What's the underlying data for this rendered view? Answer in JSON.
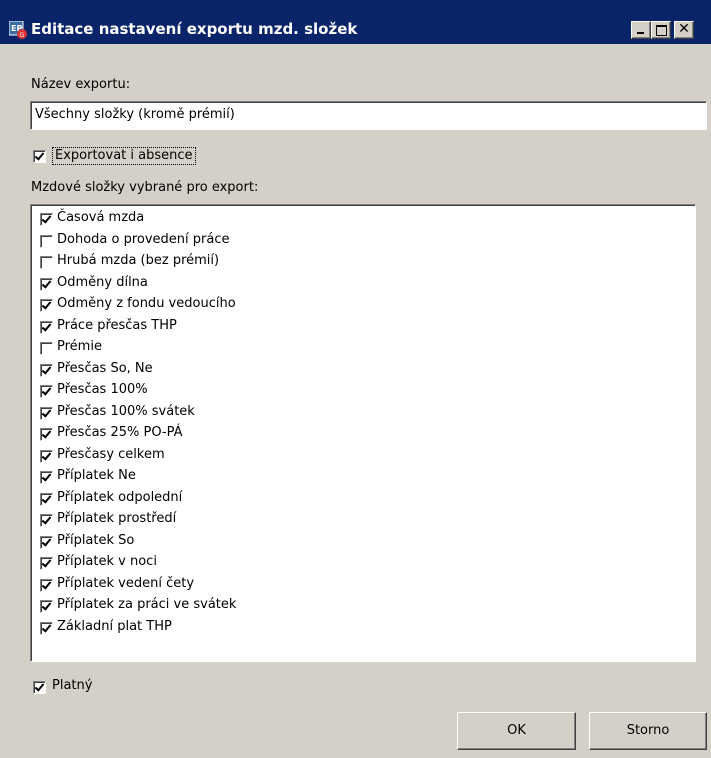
{
  "window": {
    "title": "Editace nastavení exportu mzd. složek",
    "icon": "app-icon",
    "controls": {
      "minimize": "minimize-icon",
      "maximize": "maximize-icon",
      "close": "✕"
    }
  },
  "form": {
    "name_label": "Název exportu:",
    "name_value": "Všechny složky (kromě prémií)",
    "export_absence": {
      "label": "Exportovat i absence",
      "checked": true
    },
    "list_label": "Mzdové složky vybrané pro export:",
    "items": [
      {
        "label": "Časová mzda",
        "checked": true
      },
      {
        "label": "Dohoda o provedení práce",
        "checked": false
      },
      {
        "label": "Hrubá mzda (bez prémií)",
        "checked": false
      },
      {
        "label": "Odměny dílna",
        "checked": true
      },
      {
        "label": "Odměny z fondu vedoucího",
        "checked": true
      },
      {
        "label": "Práce přesčas THP",
        "checked": true
      },
      {
        "label": "Prémie",
        "checked": false
      },
      {
        "label": "Přesčas  So, Ne",
        "checked": true
      },
      {
        "label": "Přesčas 100%",
        "checked": true
      },
      {
        "label": "Přesčas 100% svátek",
        "checked": true
      },
      {
        "label": "Přesčas 25% PO-PÁ",
        "checked": true
      },
      {
        "label": "Přesčasy celkem",
        "checked": true
      },
      {
        "label": "Příplatek Ne",
        "checked": true
      },
      {
        "label": "Příplatek odpolední",
        "checked": true
      },
      {
        "label": "Příplatek prostředí",
        "checked": true
      },
      {
        "label": "Příplatek So",
        "checked": true
      },
      {
        "label": "Příplatek v noci",
        "checked": true
      },
      {
        "label": "Příplatek vedení čety",
        "checked": true
      },
      {
        "label": "Příplatek za práci ve svátek",
        "checked": true
      },
      {
        "label": "Základní plat THP",
        "checked": true
      }
    ],
    "valid": {
      "label": "Platný",
      "checked": true
    }
  },
  "buttons": {
    "ok": "OK",
    "cancel": "Storno"
  }
}
